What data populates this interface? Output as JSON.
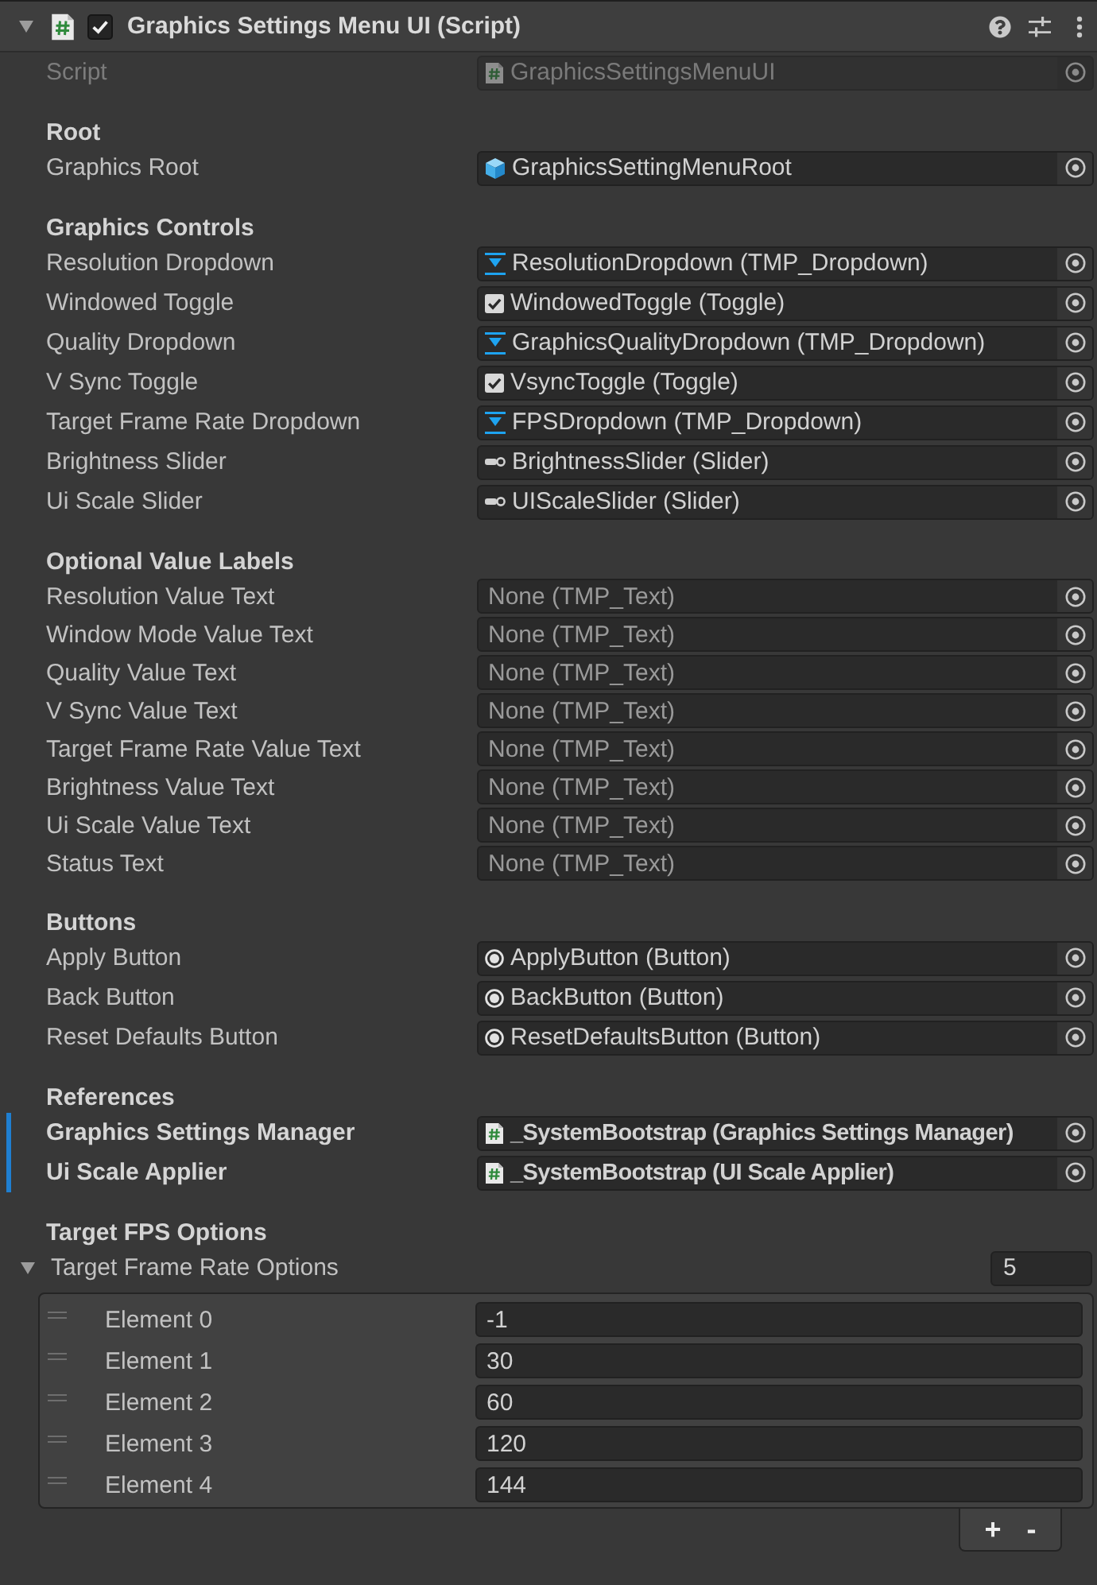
{
  "component": {
    "title": "Graphics Settings Menu UI (Script)",
    "expanded": true,
    "enabled": true
  },
  "script_field": {
    "label": "Script",
    "kind": "script",
    "value": "GraphicsSettingsMenuUI",
    "disabled": true
  },
  "sections": [
    {
      "header": "Root",
      "fields": [
        {
          "label": "Graphics Root",
          "kind": "gameobject",
          "value": "GraphicsSettingMenuRoot",
          "overridden": false
        }
      ]
    },
    {
      "header": "Graphics Controls",
      "fields": [
        {
          "label": "Resolution Dropdown",
          "kind": "dropdown",
          "value": "ResolutionDropdown (TMP_Dropdown)",
          "overridden": false
        },
        {
          "label": "Windowed Toggle",
          "kind": "toggle",
          "value": "WindowedToggle (Toggle)",
          "overridden": false
        },
        {
          "label": "Quality Dropdown",
          "kind": "dropdown",
          "value": "GraphicsQualityDropdown (TMP_Dropdown)",
          "overridden": false
        },
        {
          "label": "V Sync Toggle",
          "kind": "toggle",
          "value": "VsyncToggle (Toggle)",
          "overridden": false
        },
        {
          "label": "Target Frame Rate Dropdown",
          "kind": "dropdown",
          "value": "FPSDropdown (TMP_Dropdown)",
          "overridden": false
        },
        {
          "label": "Brightness Slider",
          "kind": "slider",
          "value": "BrightnessSlider (Slider)",
          "overridden": false
        },
        {
          "label": "Ui Scale Slider",
          "kind": "slider",
          "value": "UIScaleSlider (Slider)",
          "overridden": false
        }
      ]
    },
    {
      "header": "Optional Value Labels",
      "fields": [
        {
          "label": "Resolution Value Text",
          "kind": "none",
          "value": "None (TMP_Text)",
          "overridden": false
        },
        {
          "label": "Window Mode Value Text",
          "kind": "none",
          "value": "None (TMP_Text)",
          "overridden": false
        },
        {
          "label": "Quality Value Text",
          "kind": "none",
          "value": "None (TMP_Text)",
          "overridden": false
        },
        {
          "label": "V Sync Value Text",
          "kind": "none",
          "value": "None (TMP_Text)",
          "overridden": false
        },
        {
          "label": "Target Frame Rate Value Text",
          "kind": "none",
          "value": "None (TMP_Text)",
          "overridden": false
        },
        {
          "label": "Brightness Value Text",
          "kind": "none",
          "value": "None (TMP_Text)",
          "overridden": false
        },
        {
          "label": "Ui Scale Value Text",
          "kind": "none",
          "value": "None (TMP_Text)",
          "overridden": false
        },
        {
          "label": "Status Text",
          "kind": "none",
          "value": "None (TMP_Text)",
          "overridden": false
        }
      ]
    },
    {
      "header": "Buttons",
      "fields": [
        {
          "label": "Apply Button",
          "kind": "button",
          "value": "ApplyButton (Button)",
          "overridden": false
        },
        {
          "label": "Back Button",
          "kind": "button",
          "value": "BackButton (Button)",
          "overridden": false
        },
        {
          "label": "Reset Defaults Button",
          "kind": "button",
          "value": "ResetDefaultsButton (Button)",
          "overridden": false
        }
      ]
    },
    {
      "header": "References",
      "fields": [
        {
          "label": "Graphics Settings Manager",
          "kind": "script",
          "value": "_SystemBootstrap (Graphics Settings Manager)",
          "overridden": true
        },
        {
          "label": "Ui Scale Applier",
          "kind": "script",
          "value": "_SystemBootstrap (UI Scale Applier)",
          "overridden": true
        }
      ]
    }
  ],
  "array": {
    "header": "Target FPS Options",
    "label": "Target Frame Rate Options",
    "expanded": true,
    "size": "5",
    "elements": [
      {
        "label": "Element 0",
        "value": "-1"
      },
      {
        "label": "Element 1",
        "value": "30"
      },
      {
        "label": "Element 2",
        "value": "60"
      },
      {
        "label": "Element 3",
        "value": "120"
      },
      {
        "label": "Element 4",
        "value": "144"
      }
    ],
    "add": "+",
    "remove": "-"
  }
}
